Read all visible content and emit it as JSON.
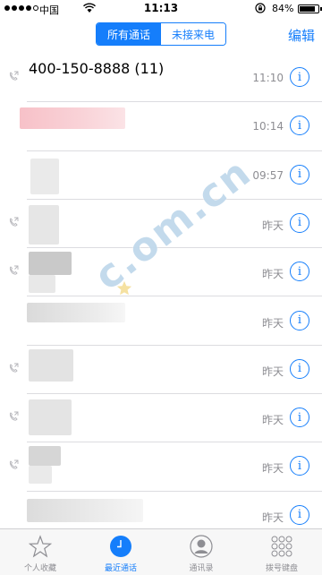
{
  "status_bar": {
    "carrier": "中国",
    "time": "11:13",
    "battery": "84%"
  },
  "nav": {
    "segments": [
      "所有通话",
      "未接来电"
    ],
    "active_segment": "所有通话",
    "edit_label": "编辑"
  },
  "calls": [
    {
      "name": "400-150-8888 (11)",
      "time": "11:10",
      "outgoing": true
    },
    {
      "name": "",
      "time": "10:14",
      "outgoing": false
    },
    {
      "name": "",
      "time": "09:57",
      "outgoing": false
    },
    {
      "name": "",
      "time": "昨天",
      "outgoing": true
    },
    {
      "name": "",
      "time": "昨天",
      "outgoing": true
    },
    {
      "name": "",
      "time": "昨天",
      "outgoing": false
    },
    {
      "name": "",
      "time": "昨天",
      "outgoing": true
    },
    {
      "name": "",
      "time": "昨天",
      "outgoing": true
    },
    {
      "name": "",
      "time": "昨天",
      "outgoing": true
    },
    {
      "name": "",
      "time": "昨天",
      "outgoing": false
    }
  ],
  "watermark": "c.om.cn",
  "tabs": [
    {
      "label": "个人收藏",
      "icon": "star-icon"
    },
    {
      "label": "最近通话",
      "icon": "clock-icon"
    },
    {
      "label": "通讯录",
      "icon": "contact-icon"
    },
    {
      "label": "拨号键盘",
      "icon": "keypad-icon"
    }
  ],
  "colors": {
    "accent": "#157efb",
    "secondary_text": "#8e8e93"
  }
}
